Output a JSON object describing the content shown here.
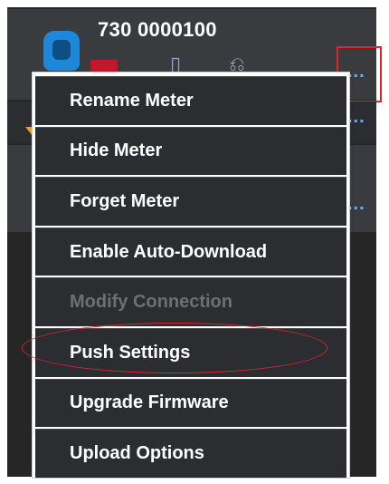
{
  "meter": {
    "id": "730 0000100",
    "more_glyph": "..."
  },
  "icons": {
    "meter": "meter-device-icon",
    "battery": "battery-icon",
    "sync": "sync-icon",
    "info": "info-icon"
  },
  "colors": {
    "accent_blue": "#1f87d8",
    "status_red": "#c0172a",
    "highlight_red": "#e0242b",
    "menu_bg": "#2c2d30",
    "disabled_text": "#6e6f73"
  },
  "menu": {
    "items": [
      {
        "label": "Rename Meter",
        "enabled": true
      },
      {
        "label": "Hide Meter",
        "enabled": true
      },
      {
        "label": "Forget Meter",
        "enabled": true
      },
      {
        "label": "Enable Auto-Download",
        "enabled": true
      },
      {
        "label": "Modify Connection",
        "enabled": false
      },
      {
        "label": "Push Settings",
        "enabled": true
      },
      {
        "label": "Upgrade Firmware",
        "enabled": true
      },
      {
        "label": "Upload Options",
        "enabled": true
      }
    ]
  }
}
